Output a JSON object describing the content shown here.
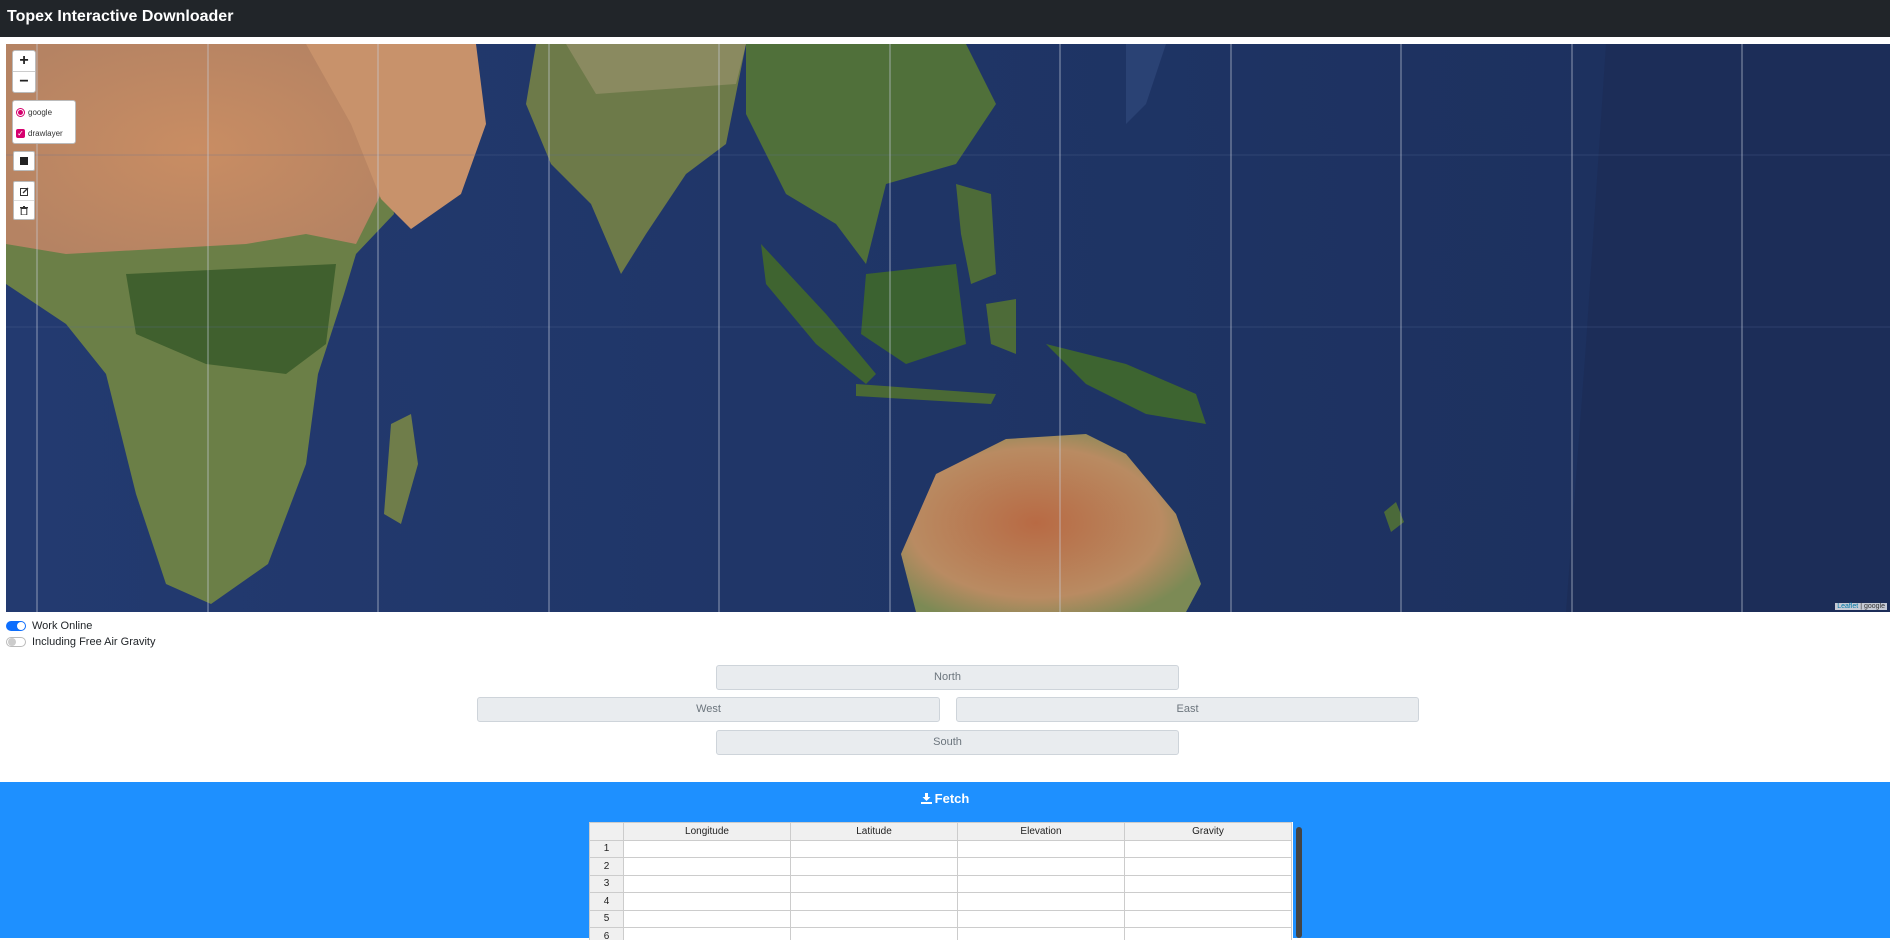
{
  "app": {
    "title": "Topex Interactive Downloader"
  },
  "map": {
    "zoom_in": "+",
    "zoom_out": "−",
    "layers": [
      {
        "label": "google",
        "type": "radio",
        "checked": true
      },
      {
        "label": "drawlayer",
        "type": "checkbox",
        "checked": true
      }
    ],
    "attribution": {
      "leaflet": "Leaflet",
      "separator": " | ",
      "provider": "google"
    }
  },
  "toggles": {
    "work_online": {
      "label": "Work Online",
      "on": true
    },
    "free_air": {
      "label": "Including Free Air Gravity",
      "on": false
    }
  },
  "bounds": {
    "north_placeholder": "North",
    "west_placeholder": "West",
    "east_placeholder": "East",
    "south_placeholder": "South"
  },
  "fetch": {
    "icon": "download-icon",
    "label": "Fetch"
  },
  "table": {
    "columns": [
      "Longitude",
      "Latitude",
      "Elevation",
      "Gravity"
    ],
    "rows": [
      "1",
      "2",
      "3",
      "4",
      "5",
      "6"
    ]
  },
  "colors": {
    "navbar": "#212529",
    "fetch_bg": "#1e90ff",
    "accent": "#d6006e",
    "switch_on": "#0d6efd"
  }
}
